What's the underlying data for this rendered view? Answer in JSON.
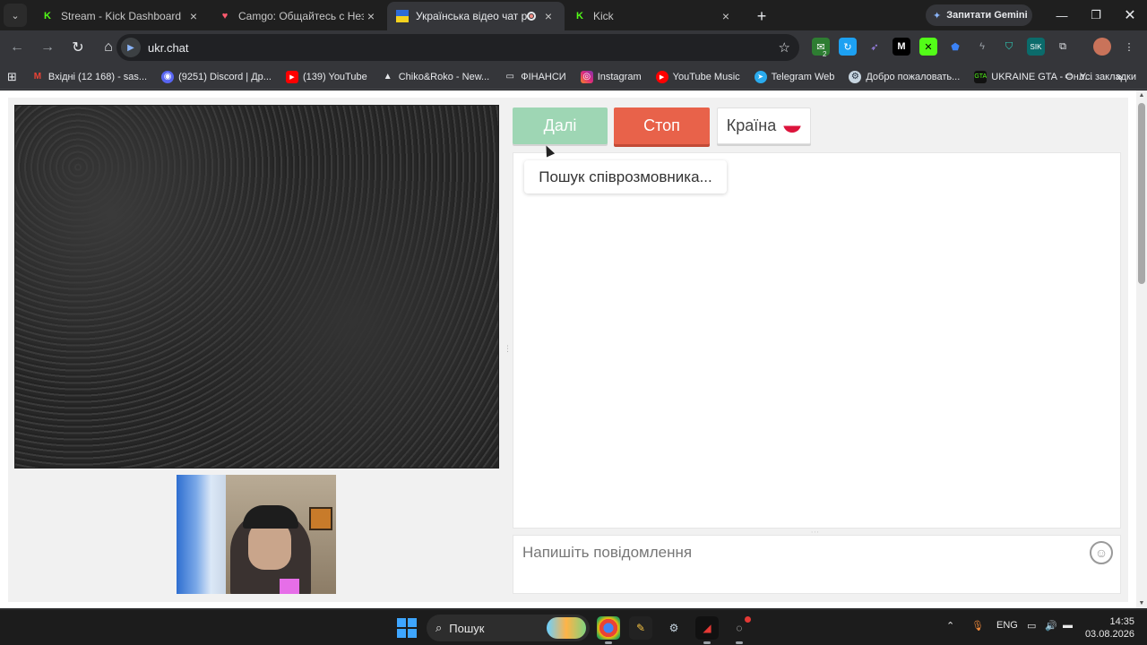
{
  "browser": {
    "tabs": [
      {
        "title": "Stream - Kick Dashboard",
        "favicon": "kick-icon",
        "active": false
      },
      {
        "title": "Camgo: Общайтесь с Незнакомцами",
        "favicon": "heart-icon",
        "active": false
      },
      {
        "title": "Українська відео чат рулетка",
        "favicon": "ukraine-flag-icon",
        "active": true
      },
      {
        "title": "Kick",
        "favicon": "kick-icon",
        "active": false
      }
    ],
    "gemini_label": "Запитати Gemini",
    "url": "ukr.chat",
    "extensions_badge": "2",
    "bookmarks": [
      {
        "label": "Вхідні (12 168) - sas...",
        "icon": "gmail-icon"
      },
      {
        "label": "(9251) Discord | Др...",
        "icon": "discord-icon"
      },
      {
        "label": "(139) YouTube",
        "icon": "youtube-icon"
      },
      {
        "label": "Chiko&Roko - New...",
        "icon": "site-icon"
      },
      {
        "label": "ФІНАНСИ",
        "icon": "folder-icon"
      },
      {
        "label": "Instagram",
        "icon": "instagram-icon"
      },
      {
        "label": "YouTube Music",
        "icon": "youtube-music-icon"
      },
      {
        "label": "Telegram Web",
        "icon": "telegram-icon"
      },
      {
        "label": "Добро пожаловать...",
        "icon": "steam-icon"
      },
      {
        "label": "UKRAINE GTA - Онл...",
        "icon": "gta-icon"
      }
    ],
    "all_bookmarks_label": "Усі закладки"
  },
  "page": {
    "next_button": "Далі",
    "stop_button": "Стоп",
    "country_button": "Країна",
    "status_message": "Пошук співрозмовника...",
    "message_placeholder": "Напишіть повідомлення"
  },
  "taskbar": {
    "search_label": "Пошук",
    "language": "ENG",
    "time": "14:35",
    "date": "03.08.2026"
  },
  "colors": {
    "next_button_bg": "#9ed6b4",
    "stop_button_bg": "#e8624a",
    "kick_green": "#53fc18"
  }
}
